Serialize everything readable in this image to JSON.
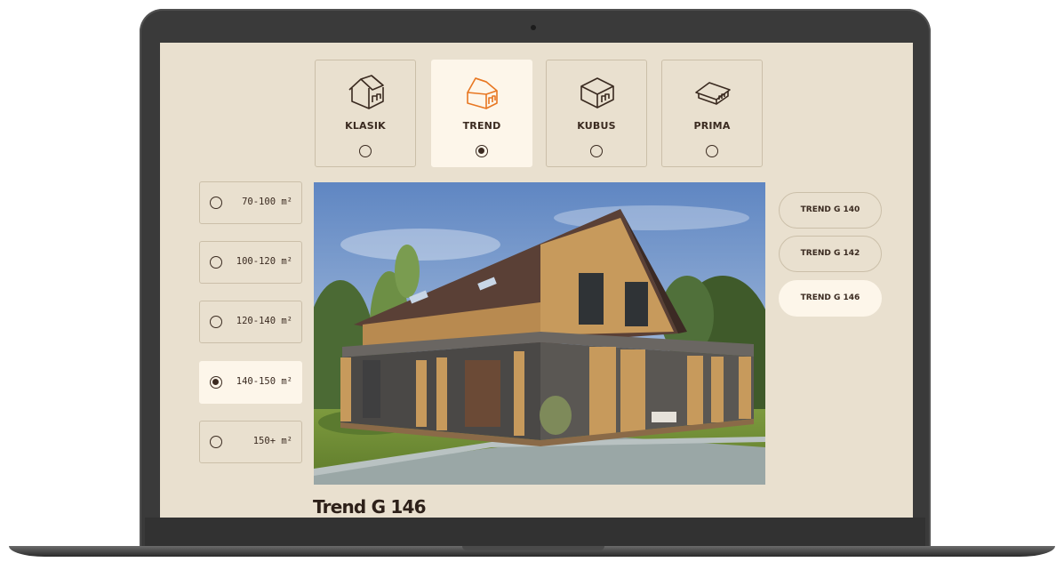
{
  "types": [
    {
      "label": "KLASIK",
      "selected": false,
      "icon": "gable-house-icon"
    },
    {
      "label": "TREND",
      "selected": true,
      "icon": "trend-house-icon"
    },
    {
      "label": "KUBUS",
      "selected": false,
      "icon": "cube-house-icon"
    },
    {
      "label": "PRIMA",
      "selected": false,
      "icon": "low-roof-house-icon"
    }
  ],
  "sizes": [
    {
      "label": "70-100 m²",
      "selected": false
    },
    {
      "label": "100-120 m²",
      "selected": false
    },
    {
      "label": "120-140 m²",
      "selected": false
    },
    {
      "label": "140-150 m²",
      "selected": true
    },
    {
      "label": "150+ m²",
      "selected": false
    }
  ],
  "models": [
    {
      "label": "TREND G 140",
      "selected": false
    },
    {
      "label": "TREND G 142",
      "selected": false
    },
    {
      "label": "TREND G 146",
      "selected": true
    }
  ],
  "house": {
    "title": "Trend G 146"
  },
  "colors": {
    "background": "#e9e0cf",
    "selected": "#fdf6ea",
    "accent": "#e87722",
    "text": "#3a2a20"
  }
}
